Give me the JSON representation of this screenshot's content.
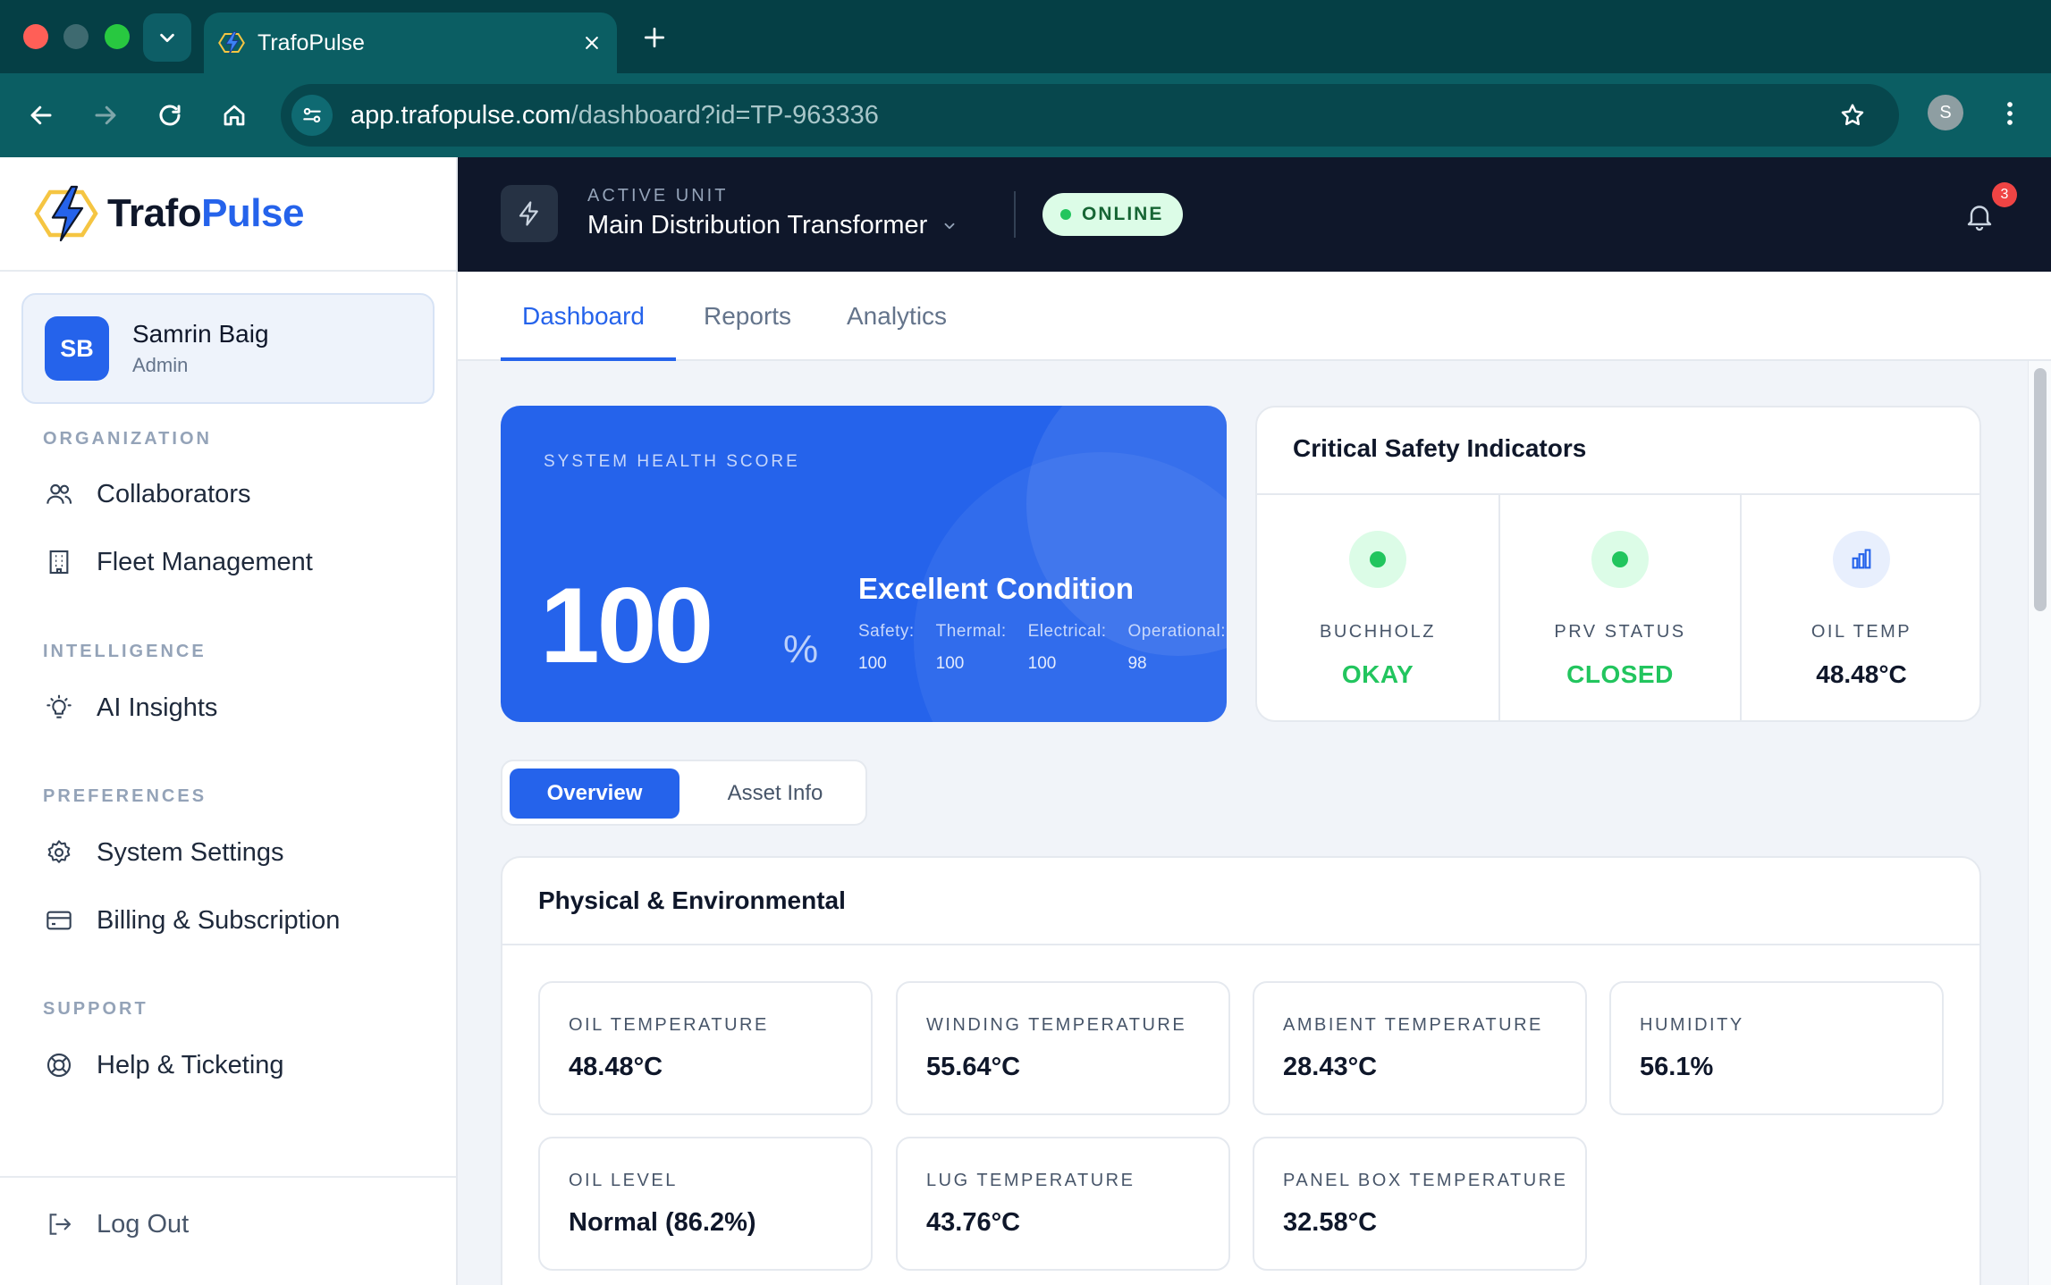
{
  "browser": {
    "tab_title": "TrafoPulse",
    "url_host": "app.trafopulse.com",
    "url_path": "/dashboard?id=TP-963336",
    "profile_initial": "S"
  },
  "brand": {
    "part1": "Trafo",
    "part2": "Pulse"
  },
  "user": {
    "initials": "SB",
    "name": "Samrin Baig",
    "role": "Admin"
  },
  "sidebar": {
    "sections": [
      {
        "label": "ORGANIZATION",
        "items": [
          {
            "label": "Collaborators",
            "icon": "users-icon"
          },
          {
            "label": "Fleet Management",
            "icon": "building-icon"
          }
        ]
      },
      {
        "label": "INTELLIGENCE",
        "items": [
          {
            "label": "AI Insights",
            "icon": "lightbulb-icon"
          }
        ]
      },
      {
        "label": "PREFERENCES",
        "items": [
          {
            "label": "System Settings",
            "icon": "gear-icon"
          },
          {
            "label": "Billing & Subscription",
            "icon": "credit-card-icon"
          }
        ]
      },
      {
        "label": "SUPPORT",
        "items": [
          {
            "label": "Help & Ticketing",
            "icon": "lifebuoy-icon"
          }
        ]
      }
    ],
    "logout": "Log Out"
  },
  "header": {
    "unit_label": "ACTIVE UNIT",
    "unit_name": "Main Distribution Transformer",
    "status": "ONLINE",
    "notification_count": "3",
    "colors": {
      "background": "#0f172a",
      "status_bg": "#dcfce7",
      "badge": "#ef4444"
    }
  },
  "tabs": [
    "Dashboard",
    "Reports",
    "Analytics"
  ],
  "active_tab": "Dashboard",
  "health": {
    "label": "SYSTEM HEALTH SCORE",
    "score": "100",
    "unit": "%",
    "condition": "Excellent Condition",
    "subscores": [
      {
        "label": "Safety:",
        "value": "100"
      },
      {
        "label": "Thermal:",
        "value": "100"
      },
      {
        "label": "Electrical:",
        "value": "100"
      },
      {
        "label": "Operational:",
        "value": "98"
      }
    ],
    "color": "#2563eb"
  },
  "safety": {
    "title": "Critical Safety Indicators",
    "indicators": [
      {
        "label": "BUCHHOLZ",
        "value": "OKAY",
        "icon": "status-dot-icon",
        "color": "#22c55e"
      },
      {
        "label": "PRV STATUS",
        "value": "CLOSED",
        "icon": "status-dot-icon",
        "color": "#22c55e"
      },
      {
        "label": "OIL TEMP",
        "value": "48.48°C",
        "icon": "bar-chart-icon",
        "color": "#0f172a"
      }
    ]
  },
  "view_toggle": {
    "options": [
      "Overview",
      "Asset Info"
    ],
    "selected": "Overview"
  },
  "physical": {
    "title": "Physical & Environmental",
    "metrics": [
      {
        "label": "OIL TEMPERATURE",
        "value": "48.48°C"
      },
      {
        "label": "WINDING TEMPERATURE",
        "value": "55.64°C"
      },
      {
        "label": "AMBIENT TEMPERATURE",
        "value": "28.43°C"
      },
      {
        "label": "HUMIDITY",
        "value": "56.1%"
      },
      {
        "label": "OIL LEVEL",
        "value": "Normal (86.2%)"
      },
      {
        "label": "LUG TEMPERATURE",
        "value": "43.76°C"
      },
      {
        "label": "PANEL BOX TEMPERATURE",
        "value": "32.58°C"
      }
    ]
  }
}
